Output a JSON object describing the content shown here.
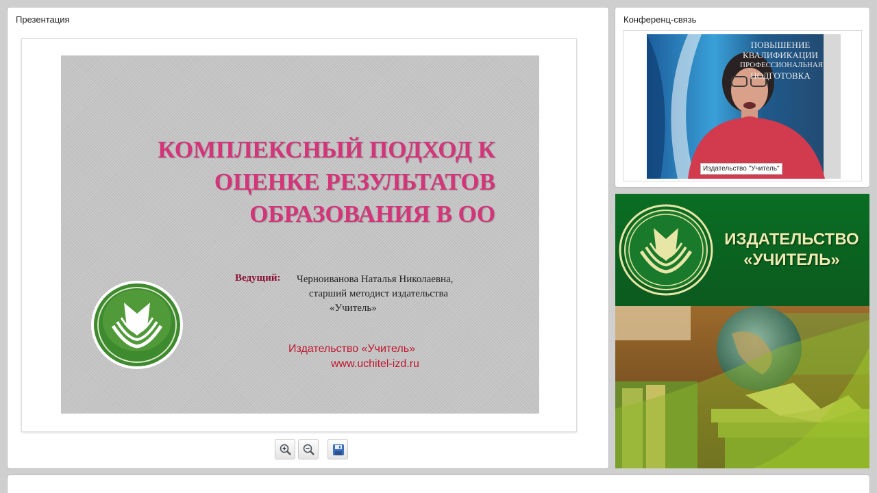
{
  "presentation": {
    "title": "Презентация",
    "slide": {
      "heading_lines": [
        "КОМПЛЕКСНЫЙ ПОДХОД К",
        "ОЦЕНКЕ РЕЗУЛЬТАТОВ",
        "ОБРАЗОВАНИЯ В ОО"
      ],
      "presenter_label": "Ведущий:",
      "presenter_lines": [
        "Черноиванова Наталья Николаевна,",
        "старший методист издательства",
        "«Учитель»"
      ],
      "publisher_name": "Издательство «Учитель»",
      "publisher_url": "www.uchitel-izd.ru"
    },
    "toolbar": {
      "zoom_in": "zoom-in-icon",
      "zoom_out": "zoom-out-icon",
      "save": "save-icon"
    }
  },
  "conference": {
    "title": "Конференц-связь",
    "video_caption": "Издательство \"Учитель\"",
    "backdrop_lines": [
      "ПОВЫШЕНИЕ",
      "КВАЛИФИКАЦИИ",
      "ПРОФЕССИОНАЛЬНАЯ",
      "ПОДГОТОВКА"
    ]
  },
  "banner": {
    "name_lines": [
      "ИЗДАТЕЛЬСТВО",
      "«УЧИТЕЛЬ»"
    ]
  },
  "colors": {
    "slide_title": "#d4357a",
    "banner_green": "#0b5a1e",
    "banner_text": "#ecebb0"
  }
}
